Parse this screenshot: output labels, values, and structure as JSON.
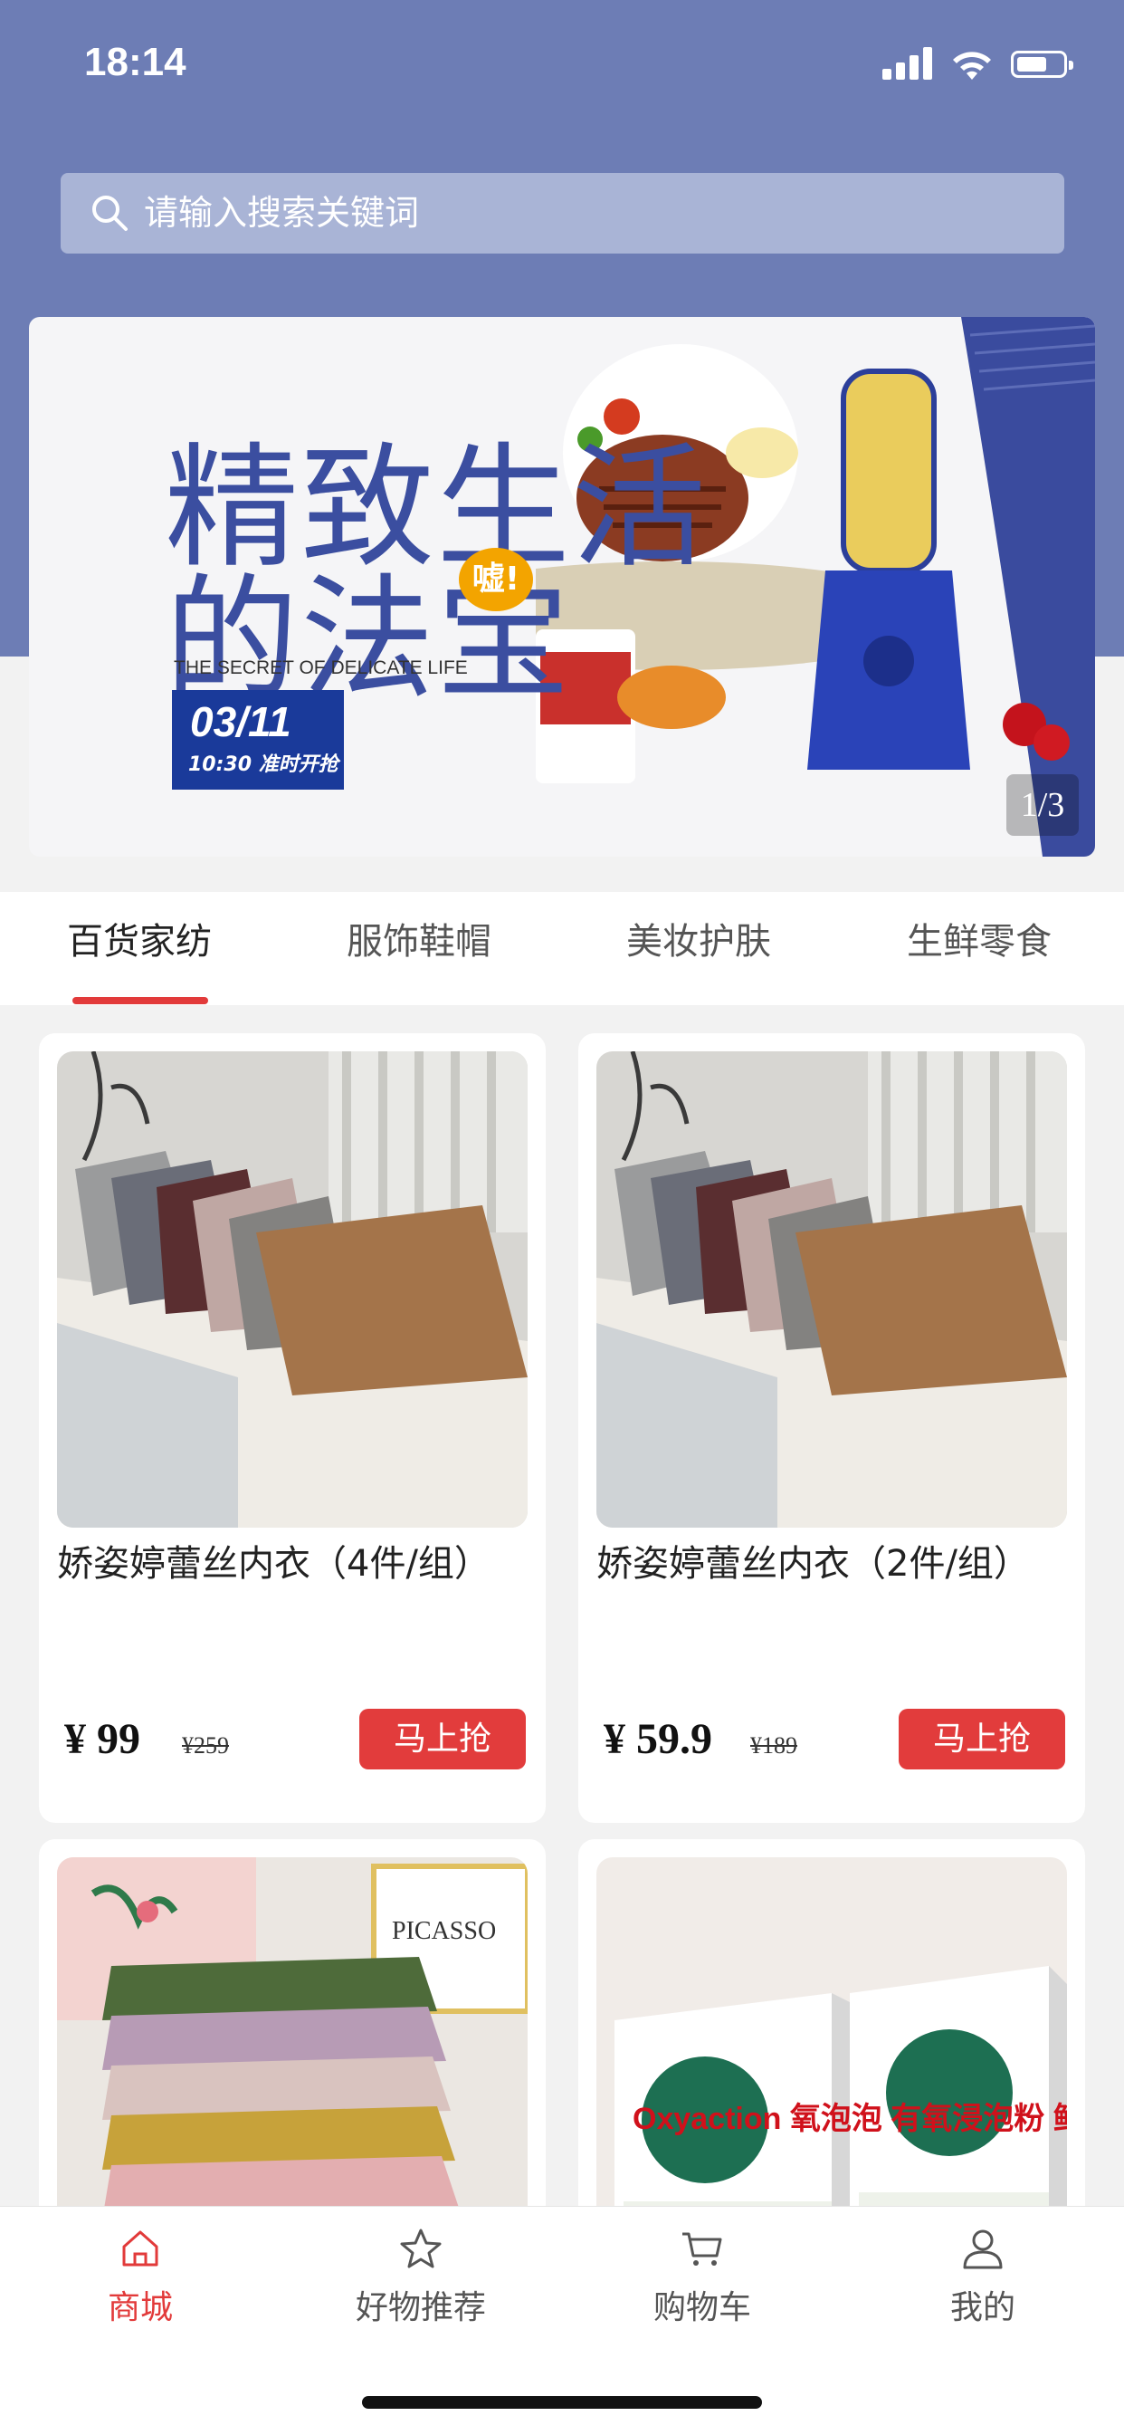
{
  "status_bar": {
    "time": "18:14"
  },
  "search": {
    "placeholder": "请输入搜索关键词"
  },
  "banner": {
    "title_line1": "精致生活",
    "title_line2": "的法宝",
    "bubble": "嘘!",
    "subtitle": "THE SECRET OF DELICATE LIFE",
    "date": "03/11",
    "time_text": "10:30 准时开抢",
    "indicator": "1/3"
  },
  "tabs": [
    {
      "label": "百货家纺",
      "active": true
    },
    {
      "label": "服饰鞋帽"
    },
    {
      "label": "美妆护肤"
    },
    {
      "label": "生鲜零食"
    }
  ],
  "products": [
    {
      "name": "娇姿婷蕾丝内衣（4件/组）",
      "price": "¥ 99",
      "old_price": "¥259",
      "button": "马上抢"
    },
    {
      "name": "娇姿婷蕾丝内衣（2件/组）",
      "price": "¥ 59.9",
      "old_price": "¥189",
      "button": "马上抢"
    },
    {
      "name": "",
      "image_text": "PICASSO"
    },
    {
      "name": "",
      "image_text": "Oxyaction 氧泡泡 有氧浸泡粉 鲜氧颗粒"
    }
  ],
  "tabbar": [
    {
      "label": "商城",
      "icon": "home-icon",
      "active": true
    },
    {
      "label": "好物推荐",
      "icon": "star-icon"
    },
    {
      "label": "购物车",
      "icon": "cart-icon"
    },
    {
      "label": "我的",
      "icon": "user-icon"
    }
  ],
  "colors": {
    "header": "#6d7db5",
    "accent": "#e23a3a"
  }
}
